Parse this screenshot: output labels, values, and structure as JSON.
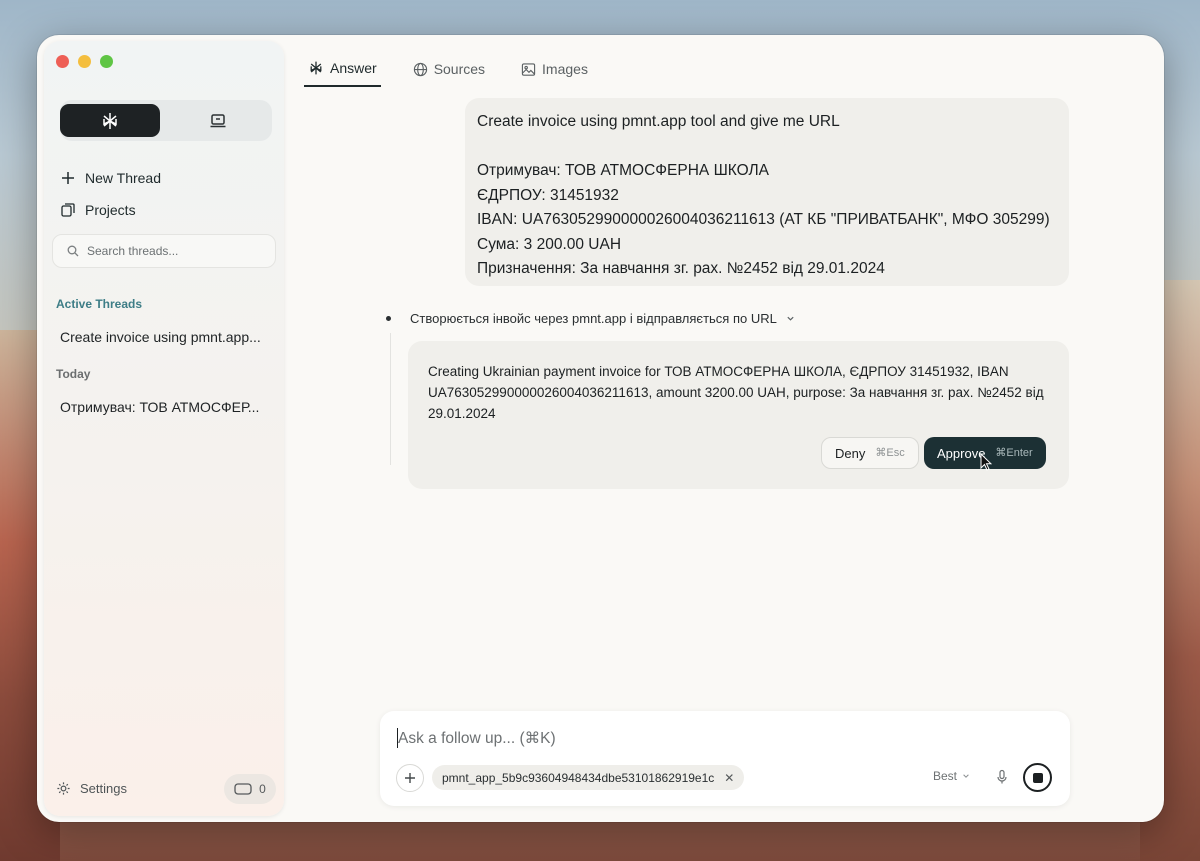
{
  "sidebar": {
    "mode_toggle": {
      "active_icon": "sparkle-logo-icon",
      "inactive_icon": "laptop-icon"
    },
    "nav": [
      {
        "label": "New Thread",
        "icon": "plus-icon"
      },
      {
        "label": "Projects",
        "icon": "projects-icon"
      }
    ],
    "search": {
      "placeholder": "Search threads..."
    },
    "sections": {
      "active_title": "Active Threads",
      "active_threads": [
        "Create invoice using pmnt.app..."
      ],
      "today_title": "Today",
      "today_threads": [
        "Отримувач: ТОВ АТМОСФЕР..."
      ]
    },
    "settings_label": "Settings",
    "counter_value": "0"
  },
  "tabs": [
    {
      "label": "Answer",
      "icon": "sparkle-logo-icon",
      "active": true
    },
    {
      "label": "Sources",
      "icon": "globe-icon",
      "active": false
    },
    {
      "label": "Images",
      "icon": "image-icon",
      "active": false
    }
  ],
  "user_message": {
    "lines": [
      "Create invoice using pmnt.app tool and give me URL",
      "",
      "Отримувач: ТОВ АТМОСФЕРНА ШКОЛА",
      "ЄДРПОУ: 31451932",
      "IBAN: UA763052990000026004036211613 (АТ КБ \"ПРИВАТБАНК\", МФО 305299)",
      "Сума: 3 200.00 UAH",
      "Призначення: За навчання зг. рах. №2452 від 29.01.2024"
    ]
  },
  "step": {
    "label": "Створюється інвойс через pmnt.app і відправляється по URL"
  },
  "approval_card": {
    "text": "Creating Ukrainian payment invoice for ТОВ АТМОСФЕРНА ШКОЛА, ЄДРПОУ 31451932, IBAN UA763052990000026004036211613, amount 3200.00 UAH, purpose: За навчання зг. рах. №2452 від 29.01.2024",
    "deny_label": "Deny",
    "deny_shortcut": "⌘Esc",
    "approve_label": "Approve",
    "approve_shortcut": "⌘Enter"
  },
  "composer": {
    "placeholder": "Ask a follow up... (⌘K)",
    "attachment": "pmnt_app_5b9c93604948434dbe53101862919e1c",
    "model": "Best"
  },
  "colors": {
    "accent_dark": "#1c3034",
    "section_accent": "#3d7d86"
  }
}
